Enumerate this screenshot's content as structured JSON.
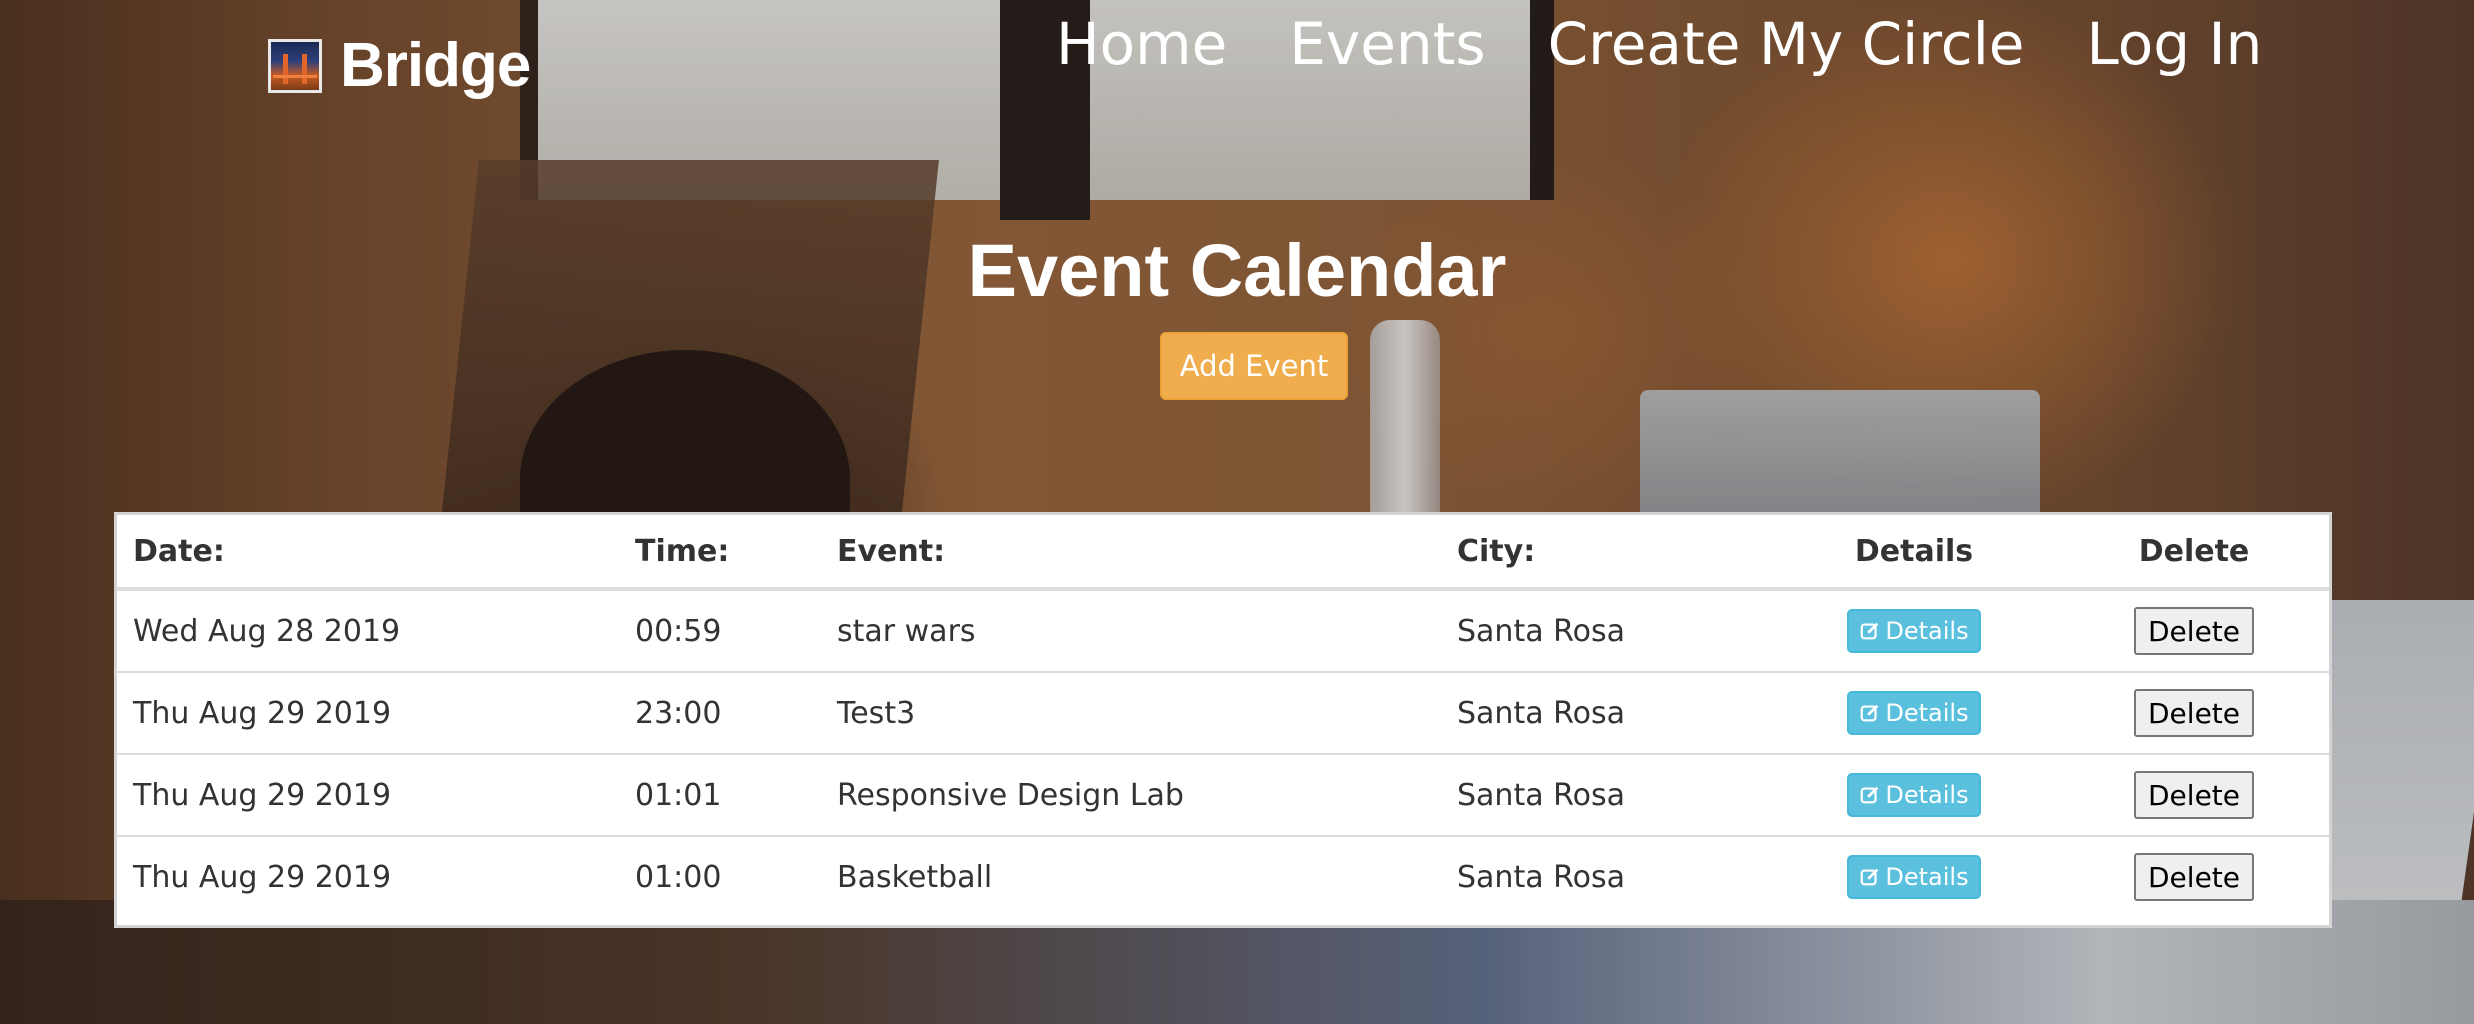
{
  "brand": {
    "name": "Bridge",
    "logo_icon": "bridge-logo-icon"
  },
  "nav": {
    "items": [
      "Home",
      "Events",
      "Create My Circle",
      "Log In"
    ]
  },
  "page": {
    "title": "Event Calendar",
    "add_event_label": "Add Event"
  },
  "table": {
    "headers": {
      "date": "Date:",
      "time": "Time:",
      "event": "Event:",
      "city": "City:",
      "details": "Details",
      "delete": "Delete"
    },
    "rows": [
      {
        "date": "Wed Aug 28 2019",
        "time": "00:59",
        "event": "star wars",
        "city": "Santa Rosa",
        "details_label": "Details",
        "delete_label": "Delete"
      },
      {
        "date": "Thu Aug 29 2019",
        "time": "23:00",
        "event": "Test3",
        "city": "Santa Rosa",
        "details_label": "Details",
        "delete_label": "Delete"
      },
      {
        "date": "Thu Aug 29 2019",
        "time": "01:01",
        "event": "Responsive Design Lab",
        "city": "Santa Rosa",
        "details_label": "Details",
        "delete_label": "Delete"
      },
      {
        "date": "Thu Aug 29 2019",
        "time": "01:00",
        "event": "Basketball",
        "city": "Santa Rosa",
        "details_label": "Details",
        "delete_label": "Delete"
      }
    ]
  },
  "colors": {
    "add_event": "#f0ad4e",
    "details": "#5bc0de",
    "header_text": "#ffffff",
    "table_text": "#333333"
  }
}
